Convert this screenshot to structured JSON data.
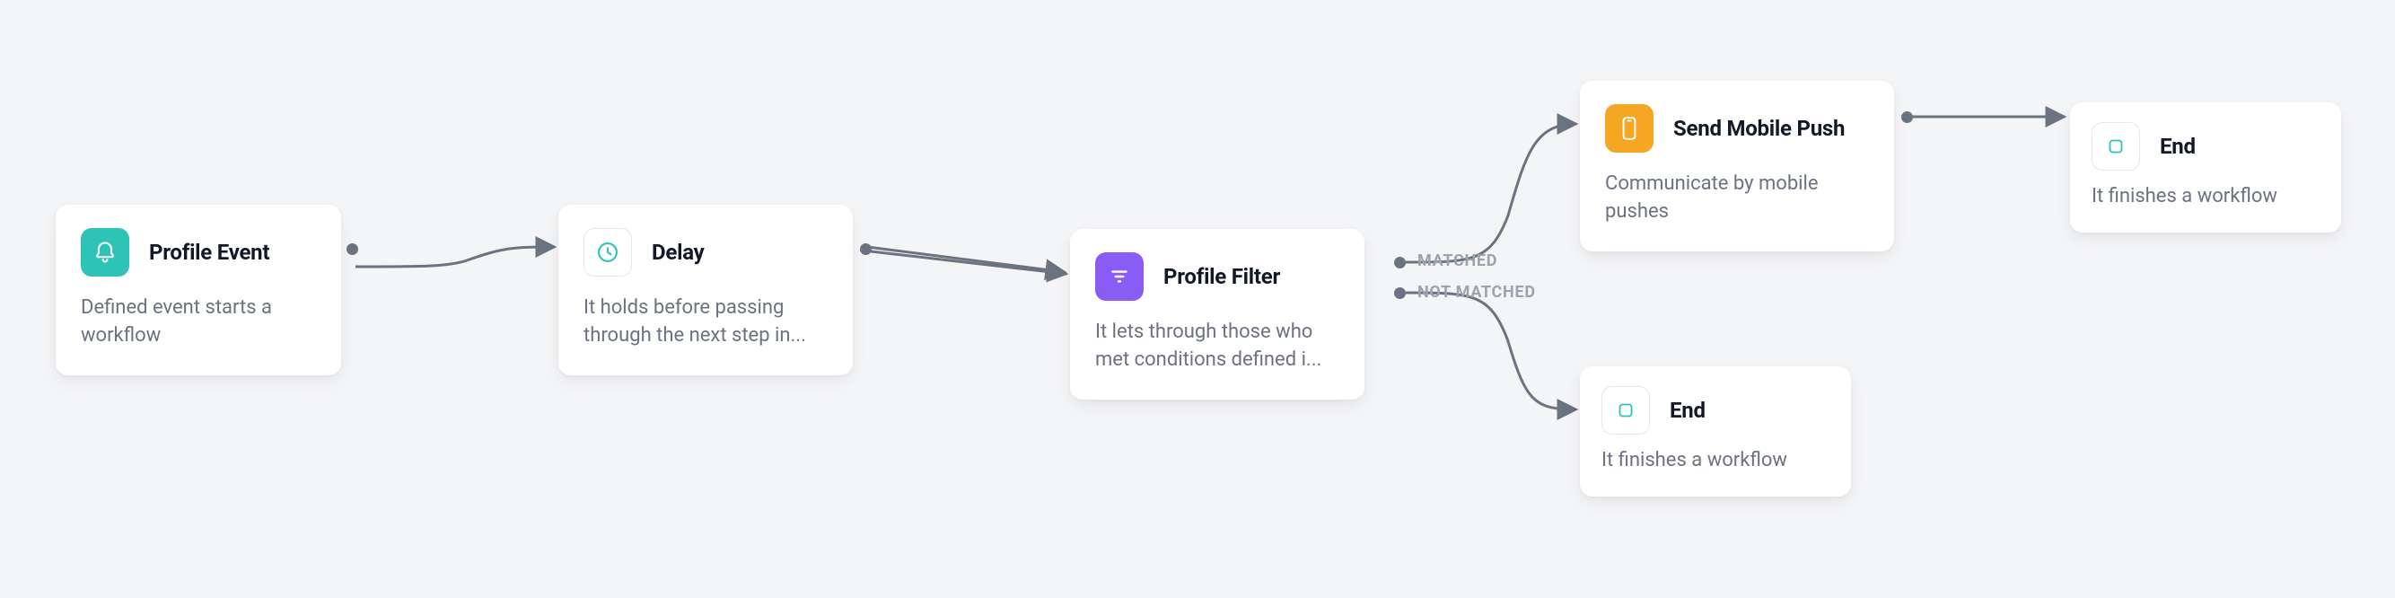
{
  "nodes": {
    "profile_event": {
      "title": "Profile Event",
      "desc": "Defined event starts a workflow",
      "icon": "bell-icon",
      "color": "teal"
    },
    "delay": {
      "title": "Delay",
      "desc": "It holds before passing through the next step in...",
      "icon": "clock-icon",
      "color": "white"
    },
    "profile_filter": {
      "title": "Profile Filter",
      "desc": "It lets through those who met conditions defined i...",
      "icon": "filter-icon",
      "color": "violet"
    },
    "send_push": {
      "title": "Send Mobile Push",
      "desc": "Communicate by mobile pushes",
      "icon": "mobile-icon",
      "color": "amber"
    },
    "end_top": {
      "title": "End",
      "desc": "It finishes a workflow",
      "icon": "stop-icon",
      "color": "white"
    },
    "end_bottom": {
      "title": "End",
      "desc": "It finishes a workflow",
      "icon": "stop-icon",
      "color": "white"
    }
  },
  "branches": {
    "matched": "MATCHED",
    "not_matched": "NOT MATCHED"
  },
  "connectors": {
    "stroke": "#6b7280",
    "dot": "#6b7280"
  },
  "chart_data": {
    "type": "flowchart",
    "nodes": [
      {
        "id": "profile_event",
        "label": "Profile Event",
        "kind": "trigger"
      },
      {
        "id": "delay",
        "label": "Delay",
        "kind": "timing"
      },
      {
        "id": "profile_filter",
        "label": "Profile Filter",
        "kind": "condition"
      },
      {
        "id": "send_push",
        "label": "Send Mobile Push",
        "kind": "action"
      },
      {
        "id": "end_top",
        "label": "End",
        "kind": "terminal"
      },
      {
        "id": "end_bottom",
        "label": "End",
        "kind": "terminal"
      }
    ],
    "edges": [
      {
        "from": "profile_event",
        "to": "delay"
      },
      {
        "from": "delay",
        "to": "profile_filter"
      },
      {
        "from": "profile_filter",
        "to": "send_push",
        "label": "MATCHED"
      },
      {
        "from": "profile_filter",
        "to": "end_bottom",
        "label": "NOT MATCHED"
      },
      {
        "from": "send_push",
        "to": "end_top"
      }
    ]
  }
}
